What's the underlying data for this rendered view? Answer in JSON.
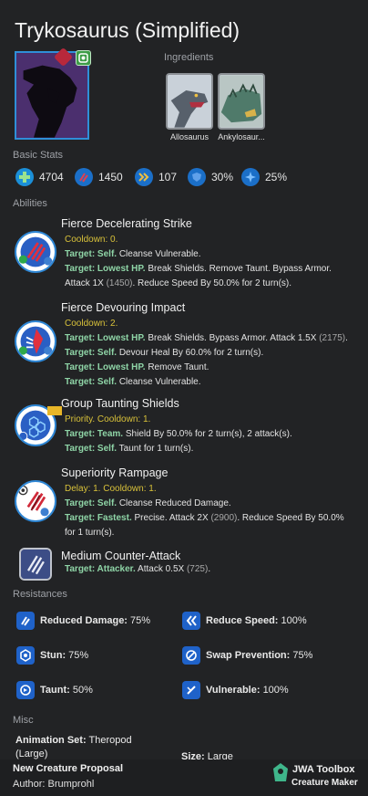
{
  "title": "Trykosaurus (Simplified)",
  "ingredients": {
    "label": "Ingredients",
    "items": [
      {
        "name": "Allosaurus"
      },
      {
        "name": "Ankylosaur..."
      }
    ]
  },
  "basic_stats": {
    "label": "Basic Stats",
    "items": [
      {
        "icon": "health-icon",
        "value": "4704"
      },
      {
        "icon": "damage-icon",
        "value": "1450"
      },
      {
        "icon": "speed-icon",
        "value": "107"
      },
      {
        "icon": "armor-icon",
        "value": "30%"
      },
      {
        "icon": "crit-icon",
        "value": "25%"
      }
    ]
  },
  "abilities": {
    "label": "Abilities",
    "items": [
      {
        "name": "Fierce Decelerating Strike",
        "lines": [
          {
            "parts": [
              {
                "t": "Cooldown: 0.",
                "c": "yellow"
              }
            ]
          },
          {
            "parts": [
              {
                "t": "Target: Self.",
                "c": "tgt"
              },
              {
                "t": " Cleanse Vulnerable."
              }
            ]
          },
          {
            "parts": [
              {
                "t": "Target: Lowest HP.",
                "c": "tgt"
              },
              {
                "t": " Break Shields. Remove Taunt. Bypass Armor. Attack 1X "
              },
              {
                "t": "(1450)",
                "c": "gray"
              },
              {
                "t": ". Reduce Speed By 50.0% for 2 turn(s)."
              }
            ]
          }
        ]
      },
      {
        "name": "Fierce Devouring Impact",
        "lines": [
          {
            "parts": [
              {
                "t": "Cooldown: 2.",
                "c": "yellow"
              }
            ]
          },
          {
            "parts": [
              {
                "t": "Target: Lowest HP.",
                "c": "tgt"
              },
              {
                "t": " Break Shields. Bypass Armor. Attack 1.5X "
              },
              {
                "t": "(2175)",
                "c": "gray"
              },
              {
                "t": "."
              }
            ]
          },
          {
            "parts": [
              {
                "t": "Target: Self.",
                "c": "tgt"
              },
              {
                "t": " Devour Heal By 60.0% for 2 turn(s)."
              }
            ]
          },
          {
            "parts": [
              {
                "t": "Target: Lowest HP.",
                "c": "tgt"
              },
              {
                "t": " Remove Taunt."
              }
            ]
          },
          {
            "parts": [
              {
                "t": "Target: Self.",
                "c": "tgt"
              },
              {
                "t": " Cleanse Vulnerable."
              }
            ]
          }
        ]
      },
      {
        "name": "Group Taunting Shields",
        "lines": [
          {
            "parts": [
              {
                "t": "Priority. Cooldown: 1.",
                "c": "yellow"
              }
            ]
          },
          {
            "parts": [
              {
                "t": "Target: Team.",
                "c": "tgt"
              },
              {
                "t": " Shield By 50.0% for 2 turn(s), 2 attack(s)."
              }
            ]
          },
          {
            "parts": [
              {
                "t": "Target: Self.",
                "c": "tgt"
              },
              {
                "t": " Taunt for 1 turn(s)."
              }
            ]
          }
        ]
      },
      {
        "name": "Superiority Rampage",
        "lines": [
          {
            "parts": [
              {
                "t": "Delay: 1. Cooldown: 1.",
                "c": "yellow"
              }
            ]
          },
          {
            "parts": [
              {
                "t": "Target: Self.",
                "c": "tgt"
              },
              {
                "t": " Cleanse Reduced Damage."
              }
            ]
          },
          {
            "parts": [
              {
                "t": "Target: Fastest.",
                "c": "tgt"
              },
              {
                "t": " Precise. Attack 2X "
              },
              {
                "t": "(2900)",
                "c": "gray"
              },
              {
                "t": ". Reduce Speed By 50.0% for 1 turn(s)."
              }
            ]
          }
        ]
      },
      {
        "name": "Medium Counter-Attack",
        "lines": [
          {
            "parts": [
              {
                "t": "Target: Attacker.",
                "c": "tgt"
              },
              {
                "t": " Attack 0.5X "
              },
              {
                "t": "(725)",
                "c": "gray"
              },
              {
                "t": "."
              }
            ]
          }
        ]
      }
    ]
  },
  "resistances": {
    "label": "Resistances",
    "items": [
      {
        "name": "Reduced Damage:",
        "value": "75%",
        "icon": "reduced-damage-icon"
      },
      {
        "name": "Reduce Speed:",
        "value": "100%",
        "icon": "reduce-speed-icon"
      },
      {
        "name": "Stun:",
        "value": "75%",
        "icon": "stun-icon"
      },
      {
        "name": "Swap Prevention:",
        "value": "75%",
        "icon": "swap-prevention-icon"
      },
      {
        "name": "Taunt:",
        "value": "50%",
        "icon": "taunt-icon"
      },
      {
        "name": "Vulnerable:",
        "value": "100%",
        "icon": "vulnerable-icon"
      }
    ]
  },
  "misc": {
    "label": "Misc",
    "animation_label": "Animation Set:",
    "animation_value": "Theropod (Large)",
    "size_label": "Size:",
    "size_value": "Large"
  },
  "footer": {
    "proposal": "New Creature Proposal",
    "author_label": "Author:",
    "author": "Brumprohl",
    "brand": "JWA Toolbox",
    "brand_sub": "Creature Maker"
  },
  "colors": {
    "background": "#222325",
    "accent_blue": "#2e86d4",
    "target_green": "#8fd5a7",
    "cooldown_yellow": "#d9c23a"
  }
}
